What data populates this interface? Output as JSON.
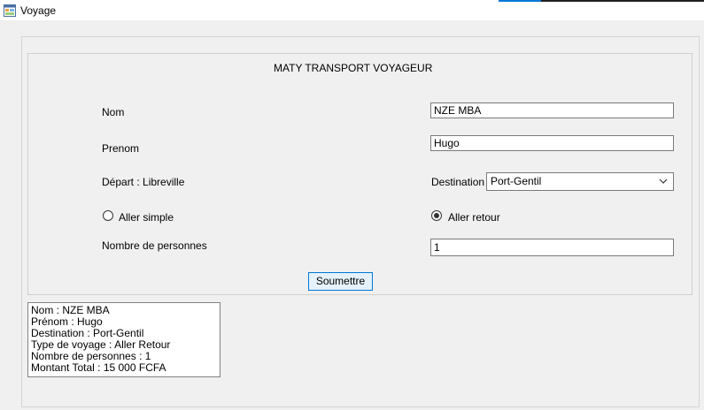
{
  "window": {
    "title": "Voyage",
    "icon": "app-window-icon"
  },
  "form": {
    "heading": "MATY TRANSPORT VOYAGEUR",
    "nom_label": "Nom",
    "nom_value": "NZE MBA",
    "prenom_label": "Prenom",
    "prenom_value": "Hugo",
    "depart_label": "Départ : Libreville",
    "destination_label": "Destination",
    "destination_value": "Port-Gentil",
    "radio_simple_label": "Aller simple",
    "radio_retour_label": "Aller retour",
    "selected_trip": "Aller retour",
    "nb_label": "Nombre de personnes",
    "nb_value": "1",
    "submit_label": "Soumettre"
  },
  "summary": {
    "lines": [
      "Nom : NZE MBA",
      "Prénom : Hugo",
      "Destination : Port-Gentil",
      "Type de voyage : Aller Retour",
      "Nombre de personnes : 1",
      "Montant Total : 15 000 FCFA"
    ]
  },
  "colors": {
    "accent": "#0078d7",
    "button_bg": "#e5f1fb",
    "background": "#f0f0f0"
  }
}
